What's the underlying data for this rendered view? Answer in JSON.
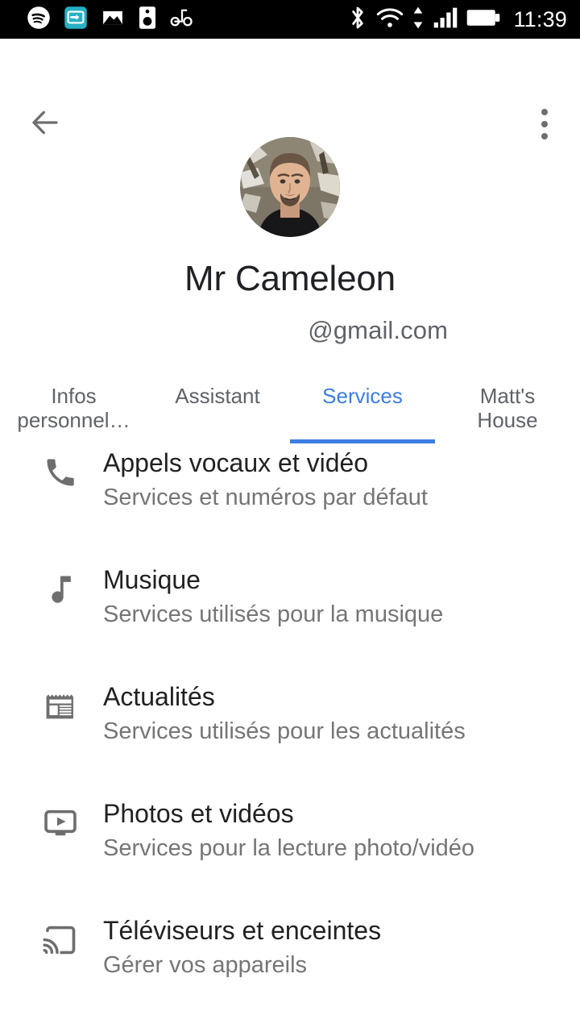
{
  "statusbar": {
    "time": "11:39",
    "left_icons": [
      {
        "name": "spotify-icon"
      },
      {
        "name": "cast-screen-mirror-icon",
        "color": "#27b0c4"
      },
      {
        "name": "photo-image-icon"
      },
      {
        "name": "speaker-icon"
      },
      {
        "name": "pedometer-icon"
      }
    ],
    "right_icons": [
      {
        "name": "bluetooth-icon"
      },
      {
        "name": "wifi-icon"
      },
      {
        "name": "data-transfer-arrows-icon"
      },
      {
        "name": "cellular-signal-icon"
      },
      {
        "name": "battery-full-icon"
      }
    ]
  },
  "appbar": {
    "back_icon": "arrow-back-icon",
    "overflow_icon": "more-vert-icon"
  },
  "profile": {
    "avatar_icon": "user-avatar-photo",
    "name": "Mr Cameleon",
    "email": "@gmail.com"
  },
  "tabs": {
    "active_index": 2,
    "accent_color": "#3d7de0",
    "items": [
      {
        "line1": "Infos",
        "line2": "personnel…"
      },
      {
        "line1": "Assistant",
        "line2": ""
      },
      {
        "line1": "Services",
        "line2": ""
      },
      {
        "line1": "Matt's",
        "line2": "House"
      }
    ]
  },
  "services_list": [
    {
      "icon": "phone-call-icon",
      "title": "Appels vocaux et vidéo",
      "subtitle": "Services et numéros par défaut"
    },
    {
      "icon": "music-note-icon",
      "title": "Musique",
      "subtitle": "Services utilisés pour la musique"
    },
    {
      "icon": "newspaper-icon",
      "title": "Actualités",
      "subtitle": "Services utilisés pour les actualités"
    },
    {
      "icon": "ondemand-video-icon",
      "title": "Photos et vidéos",
      "subtitle": "Services pour la lecture photo/vidéo"
    },
    {
      "icon": "cast-icon",
      "title": "Téléviseurs et enceintes",
      "subtitle": "Gérer vos appareils"
    }
  ]
}
